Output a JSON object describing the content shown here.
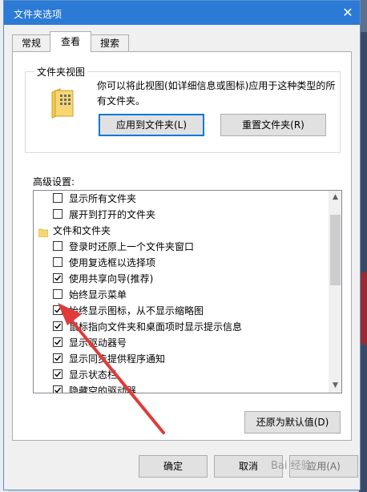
{
  "window": {
    "title": "文件夹选项"
  },
  "tabs": [
    {
      "label": "常规"
    },
    {
      "label": "查看"
    },
    {
      "label": "搜索"
    }
  ],
  "folder_view": {
    "group_title": "文件夹视图",
    "description": "你可以将此视图(如详细信息或图标)应用于这种类型的所有文件夹。",
    "apply_button": "应用到文件夹(L)",
    "reset_button": "重置文件夹(R)"
  },
  "advanced": {
    "label": "高级设置:",
    "items": [
      {
        "label": "显示所有文件夹",
        "checked": false
      },
      {
        "label": "展开到打开的文件夹",
        "checked": false
      },
      {
        "label": "文件和文件夹",
        "type": "category"
      },
      {
        "label": "登录时还原上一个文件夹窗口",
        "checked": false
      },
      {
        "label": "使用复选框以选择项",
        "checked": false
      },
      {
        "label": "使用共享向导(推荐)",
        "checked": true
      },
      {
        "label": "始终显示菜单",
        "checked": false
      },
      {
        "label": "始终显示图标，从不显示缩略图",
        "checked": true
      },
      {
        "label": "鼠标指向文件夹和桌面项时显示提示信息",
        "checked": true
      },
      {
        "label": "显示驱动器号",
        "checked": true
      },
      {
        "label": "显示同步提供程序通知",
        "checked": true
      },
      {
        "label": "显示状态栏",
        "checked": true
      },
      {
        "label": "隐藏空的驱动器",
        "checked": true
      }
    ],
    "restore_defaults_button": "还原为默认值(D)"
  },
  "footer": {
    "ok": "确定",
    "cancel": "取消",
    "apply": "应用(A)"
  },
  "watermark": "Bai 经验",
  "colors": {
    "titlebar": "#2b7ad6",
    "accent": "#0078d7",
    "arrow": "#e03a3a",
    "folder": "#f7d774"
  }
}
